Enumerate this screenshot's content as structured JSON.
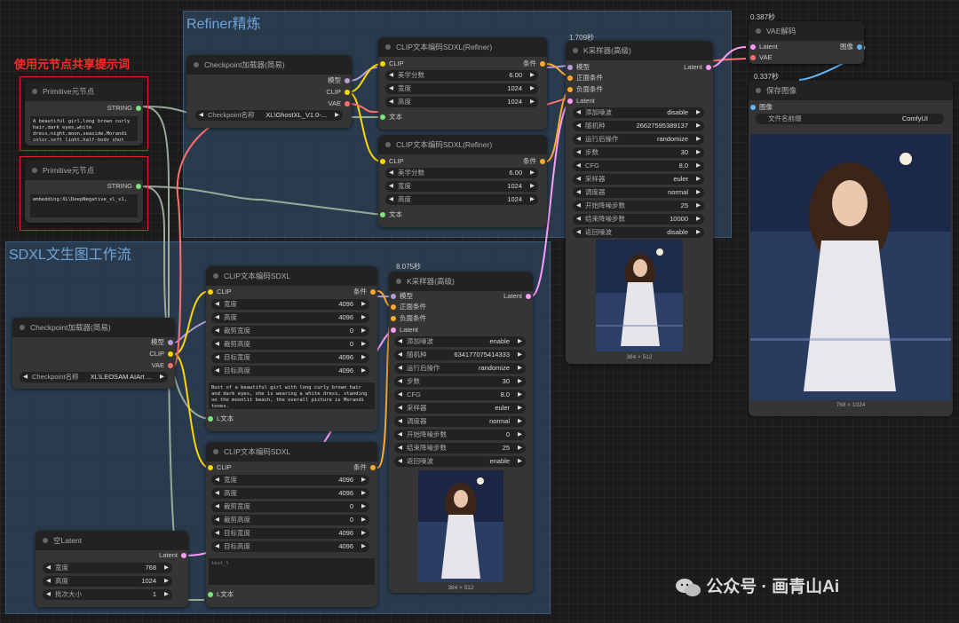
{
  "annotation": "使用元节点共享提示词",
  "groups": {
    "refiner": "Refiner精炼",
    "sdxl": "SDXL文生图工作流"
  },
  "timers": {
    "ksampler_refiner": "1.709秒",
    "vae_decode": "0.387秒",
    "save_image": "0.337秒",
    "ksampler_base": "8.075秒"
  },
  "primitive1": {
    "title": "Primitive元节点",
    "out": "STRING",
    "text": "A beautiful girl,long brown curly hair,dark eyes,white dress,night,moon,seaside,Morandi color,soft light,half-body shot"
  },
  "primitive2": {
    "title": "Primitive元节点",
    "out": "STRING",
    "text": "embedding:XL\\DeepNegative_xl_v1,"
  },
  "ckpt_refiner": {
    "title": "Checkpoint加载器(简易)",
    "outs": [
      "模型",
      "CLIP",
      "VAE"
    ],
    "widget_label": "Checkpoint名称",
    "widget_value": "XL\\GhostXL_V1.0-..."
  },
  "clip_ref_pos": {
    "title": "CLIP文本编码SDXL(Refiner)",
    "in_clip": "CLIP",
    "out": "条件",
    "widgets": [
      {
        "label": "美学分数",
        "value": "6.00"
      },
      {
        "label": "宽度",
        "value": "1024"
      },
      {
        "label": "高度",
        "value": "1024"
      }
    ],
    "in_text": "文本"
  },
  "clip_ref_neg": {
    "title": "CLIP文本编码SDXL(Refiner)",
    "in_clip": "CLIP",
    "out": "条件",
    "widgets": [
      {
        "label": "美学分数",
        "value": "6.00"
      },
      {
        "label": "宽度",
        "value": "1024"
      },
      {
        "label": "高度",
        "value": "1024"
      }
    ],
    "in_text": "文本"
  },
  "ksampler_ref": {
    "title": "K采样器(高级)",
    "ins": [
      "模型",
      "正面条件",
      "负面条件",
      "Latent"
    ],
    "out": "Latent",
    "widgets": [
      {
        "label": "添加噪波",
        "value": "disable"
      },
      {
        "label": "随机种",
        "value": "266275953891​37"
      },
      {
        "label": "运行后操作",
        "value": "randomize"
      },
      {
        "label": "步数",
        "value": "30"
      },
      {
        "label": "CFG",
        "value": "8.0"
      },
      {
        "label": "采样器",
        "value": "euler"
      },
      {
        "label": "调度器",
        "value": "normal"
      },
      {
        "label": "开始降噪步数",
        "value": "25"
      },
      {
        "label": "结束降噪步数",
        "value": "10000"
      },
      {
        "label": "返回噪波",
        "value": "disable"
      }
    ],
    "caption": "384 × 512"
  },
  "vae": {
    "title": "VAE解码",
    "ins": [
      "Latent",
      "VAE"
    ],
    "out": "图像"
  },
  "save": {
    "title": "保存图像",
    "in": "图像",
    "widget_label": "文件名前缀",
    "widget_value": "ComfyUI",
    "caption": "768 × 1024"
  },
  "ckpt_base": {
    "title": "Checkpoint加载器(简易)",
    "outs": [
      "模型",
      "CLIP",
      "VAE"
    ],
    "widget_label": "Checkpoint名称",
    "widget_value": "XL\\LEOSAM AIArt ..."
  },
  "clip_base_pos": {
    "title": "CLIP文本编码SDXL",
    "in_clip": "CLIP",
    "out": "条件",
    "widgets": [
      {
        "label": "宽度",
        "value": "4096"
      },
      {
        "label": "高度",
        "value": "4096"
      },
      {
        "label": "裁剪宽度",
        "value": "0"
      },
      {
        "label": "裁剪高度",
        "value": "0"
      },
      {
        "label": "目标宽度",
        "value": "4096"
      },
      {
        "label": "目标高度",
        "value": "4096"
      }
    ],
    "text": "Bust of a beautiful girl with long curly brown hair and dark eyes, she is wearing a white dress, standing on the moonlit beach, the overall picture is Morandi tones.",
    "in_text": "L文本"
  },
  "clip_base_neg": {
    "title": "CLIP文本编码SDXL",
    "in_clip": "CLIP",
    "out": "条件",
    "widgets": [
      {
        "label": "宽度",
        "value": "4096"
      },
      {
        "label": "高度",
        "value": "4096"
      },
      {
        "label": "裁剪宽度",
        "value": "0"
      },
      {
        "label": "裁剪高度",
        "value": "0"
      },
      {
        "label": "目标宽度",
        "value": "4096"
      },
      {
        "label": "目标高度",
        "value": "4096"
      }
    ],
    "text": "text_l",
    "in_text": "L文本"
  },
  "ksampler_base": {
    "title": "K采样器(高级)",
    "ins": [
      "模型",
      "正面条件",
      "负面条件",
      "Latent"
    ],
    "out": "Latent",
    "widgets": [
      {
        "label": "添加噪波",
        "value": "enable"
      },
      {
        "label": "随机种",
        "value": "634177075414333"
      },
      {
        "label": "运行后操作",
        "value": "randomize"
      },
      {
        "label": "步数",
        "value": "30"
      },
      {
        "label": "CFG",
        "value": "8.0"
      },
      {
        "label": "采样器",
        "value": "euler"
      },
      {
        "label": "调度器",
        "value": "normal"
      },
      {
        "label": "开始降噪步数",
        "value": "0"
      },
      {
        "label": "结束降噪步数",
        "value": "25"
      },
      {
        "label": "返回噪波",
        "value": "enable"
      }
    ],
    "caption": "384 × 512"
  },
  "latent": {
    "title": "空Latent",
    "out": "Latent",
    "widgets": [
      {
        "label": "宽度",
        "value": "768"
      },
      {
        "label": "高度",
        "value": "1024"
      },
      {
        "label": "批次大小",
        "value": "1"
      }
    ]
  },
  "watermark": "公众号 · 画青山Ai",
  "colors": {
    "clip": "#ffd500",
    "model": "#b39ddb",
    "vae": "#ff6e6e",
    "conditioning": "#ffa931",
    "latent": "#ff9cf9",
    "string": "#7de37d",
    "image": "#64b5f6"
  }
}
